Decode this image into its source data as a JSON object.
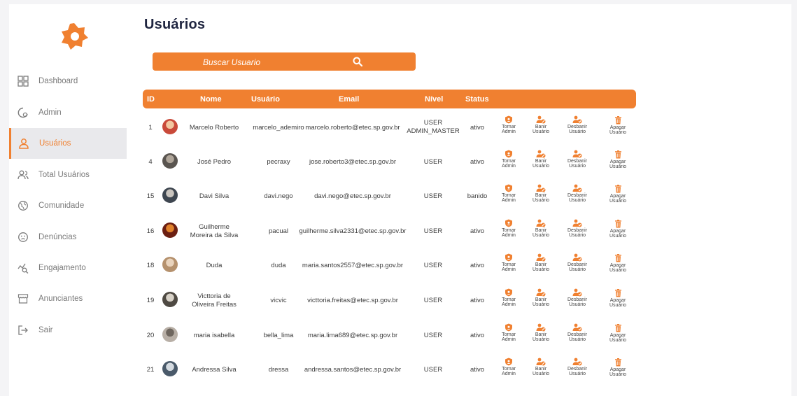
{
  "page_title": "Usuários",
  "search": {
    "placeholder": "Buscar Usuario"
  },
  "sidebar": {
    "items": [
      {
        "label": "Dashboard",
        "icon": "grid-icon"
      },
      {
        "label": "Admin",
        "icon": "admin-shield-icon"
      },
      {
        "label": "Usuários",
        "icon": "user-icon",
        "active": true
      },
      {
        "label": "Total Usuários",
        "icon": "users-group-icon"
      },
      {
        "label": "Comunidade",
        "icon": "globe-icon"
      },
      {
        "label": "Denúncias",
        "icon": "alert-face-icon"
      },
      {
        "label": "Engajamento",
        "icon": "engagement-chart-icon"
      },
      {
        "label": "Anunciantes",
        "icon": "store-icon"
      },
      {
        "label": "Sair",
        "icon": "logout-icon"
      }
    ]
  },
  "table": {
    "headers": {
      "id": "ID",
      "nome": "Nome",
      "usuario": "Usuário",
      "email": "Email",
      "nivel": "Nível",
      "status": "Status"
    },
    "actions": {
      "tornar_admin": [
        "Tornar",
        "Admin"
      ],
      "banir": [
        "Banir",
        "Usuário"
      ],
      "desbanir": [
        "Desbanir",
        "Usuário"
      ],
      "apagar": [
        "Apagar",
        "Usuário"
      ]
    },
    "rows": [
      {
        "id": "1",
        "nome": [
          "Marcelo Roberto"
        ],
        "usuario": "marcelo_ademiro",
        "email": "marcelo.roberto@etec.sp.gov.br",
        "nivel": [
          "USER",
          "ADMIN_MASTER"
        ],
        "status": "ativo"
      },
      {
        "id": "4",
        "nome": [
          "José Pedro"
        ],
        "usuario": "pecraxy",
        "email": "jose.roberto3@etec.sp.gov.br",
        "nivel": [
          "USER"
        ],
        "status": "ativo"
      },
      {
        "id": "15",
        "nome": [
          "Davi Silva"
        ],
        "usuario": "davi.nego",
        "email": "davi.nego@etec.sp.gov.br",
        "nivel": [
          "USER"
        ],
        "status": "banido"
      },
      {
        "id": "16",
        "nome": [
          "Guilherme",
          "Moreira da Silva"
        ],
        "usuario": "pacual",
        "email": "guilherme.silva2331@etec.sp.gov.br",
        "nivel": [
          "USER"
        ],
        "status": "ativo"
      },
      {
        "id": "18",
        "nome": [
          "Duda"
        ],
        "usuario": "duda",
        "email": "maria.santos2557@etec.sp.gov.br",
        "nivel": [
          "USER"
        ],
        "status": "ativo"
      },
      {
        "id": "19",
        "nome": [
          "Victtoria de",
          "Oliveira Freitas"
        ],
        "usuario": "vicvic",
        "email": "victtoria.freitas@etec.sp.gov.br",
        "nivel": [
          "USER"
        ],
        "status": "ativo"
      },
      {
        "id": "20",
        "nome": [
          "maria isabella"
        ],
        "usuario": "bella_lima",
        "email": "maria.lima689@etec.sp.gov.br",
        "nivel": [
          "USER"
        ],
        "status": "ativo"
      },
      {
        "id": "21",
        "nome": [
          "Andressa Silva"
        ],
        "usuario": "dressa",
        "email": "andressa.santos@etec.sp.gov.br",
        "nivel": [
          "USER"
        ],
        "status": "ativo"
      }
    ]
  },
  "colors": {
    "accent": "#f08030",
    "title": "#1f2540",
    "active_bg": "#e9e9ec"
  }
}
